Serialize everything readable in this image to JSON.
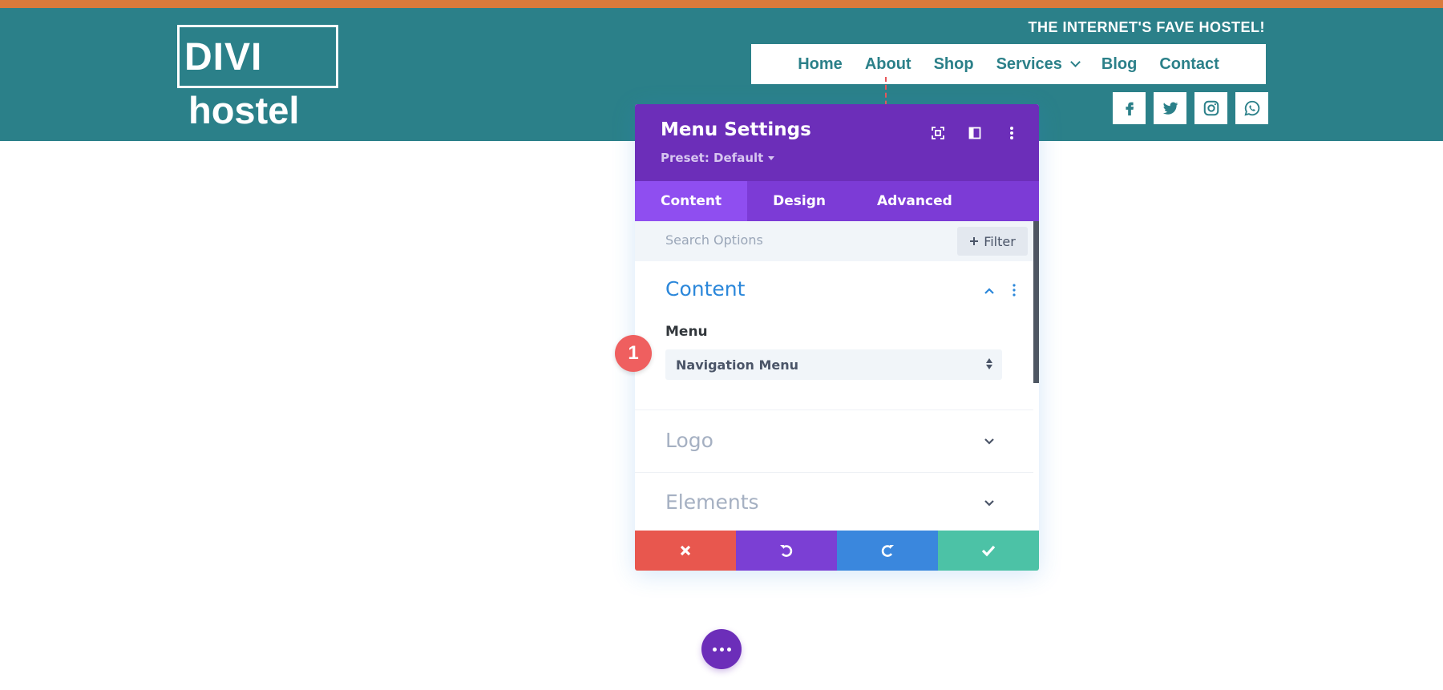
{
  "site": {
    "logo_top": "DIVI",
    "logo_bottom": "hostel",
    "tagline": "THE INTERNET'S FAVE HOSTEL!",
    "nav": [
      {
        "label": "Home"
      },
      {
        "label": "About"
      },
      {
        "label": "Shop"
      },
      {
        "label": "Services",
        "has_dropdown": true
      },
      {
        "label": "Blog"
      },
      {
        "label": "Contact"
      }
    ],
    "socials": [
      {
        "name": "facebook-icon"
      },
      {
        "name": "twitter-icon"
      },
      {
        "name": "instagram-icon"
      },
      {
        "name": "whatsapp-icon"
      }
    ],
    "colors": {
      "header": "#2b8089",
      "topbar": "#d97a3b"
    }
  },
  "modal": {
    "title": "Menu Settings",
    "preset": "Preset: Default",
    "header_icons": [
      "fullscreen-icon",
      "split-view-icon",
      "more-options-icon"
    ],
    "tabs": [
      {
        "label": "Content",
        "active": true
      },
      {
        "label": "Design",
        "active": false
      },
      {
        "label": "Advanced",
        "active": false
      }
    ],
    "search": {
      "placeholder": "Search Options",
      "value": ""
    },
    "filter_label": "Filter",
    "sections": [
      {
        "title": "Content",
        "open": true
      },
      {
        "title": "Logo",
        "open": false
      },
      {
        "title": "Elements",
        "open": false
      }
    ],
    "menu_field": {
      "label": "Menu",
      "value": "Navigation Menu"
    },
    "footer_buttons": [
      "cancel",
      "undo",
      "redo",
      "save"
    ],
    "colors": {
      "header": "#6c2eb9",
      "tabs": "#7c3bd6",
      "active_tab": "#8f4ef0",
      "cancel": "#e8574e",
      "undo": "#7b3fd4",
      "redo": "#3a87dd",
      "save": "#4cc2a6"
    }
  },
  "annotation": {
    "step": "1"
  }
}
